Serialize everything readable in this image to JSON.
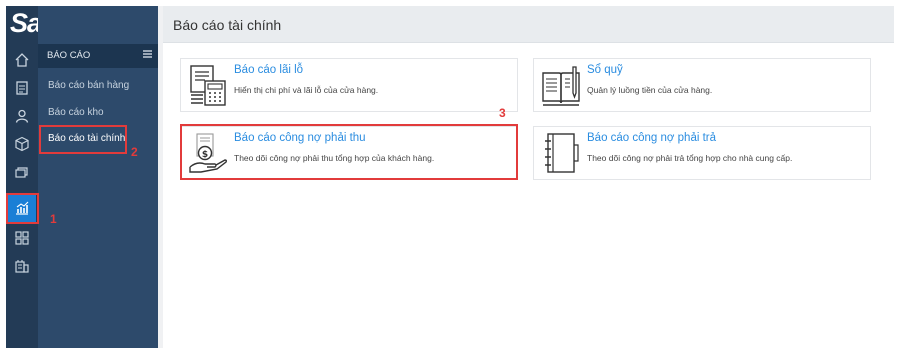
{
  "brand": {
    "logo_text": "Sapo"
  },
  "rail": {
    "icons": [
      "home-icon",
      "orders-icon",
      "customer-icon",
      "product-icon",
      "inventory-icon",
      "report-icon",
      "apps-icon",
      "settings-icon"
    ],
    "active": "report-icon",
    "accent": "#1a7fd6"
  },
  "sidebar": {
    "title": "BÁO CÁO",
    "items": [
      {
        "label": "Báo cáo bán hàng"
      },
      {
        "label": "Báo cáo kho"
      },
      {
        "label": "Báo cáo tài chính"
      }
    ]
  },
  "main": {
    "title": "Báo cáo tài chính",
    "cards": [
      {
        "title": "Báo cáo lãi lỗ",
        "desc": "Hiển thị chi phí và lãi lỗ của cửa hàng.",
        "icon": "profit-loss-icon"
      },
      {
        "title": "Sổ quỹ",
        "desc": "Quản lý luồng tiền của cửa hàng.",
        "icon": "cash-book-icon"
      },
      {
        "title": "Báo cáo công nợ phải thu",
        "desc": "Theo dõi công nợ phải thu tổng hợp của khách hàng.",
        "icon": "receivable-icon"
      },
      {
        "title": "Báo cáo công nợ phải trả",
        "desc": "Theo dõi công nợ phải trả tổng hợp cho nhà cung cấp.",
        "icon": "payable-icon"
      }
    ]
  },
  "annotations": {
    "step1": "1",
    "step2": "2",
    "step3": "3",
    "color": "#e23b3b"
  }
}
